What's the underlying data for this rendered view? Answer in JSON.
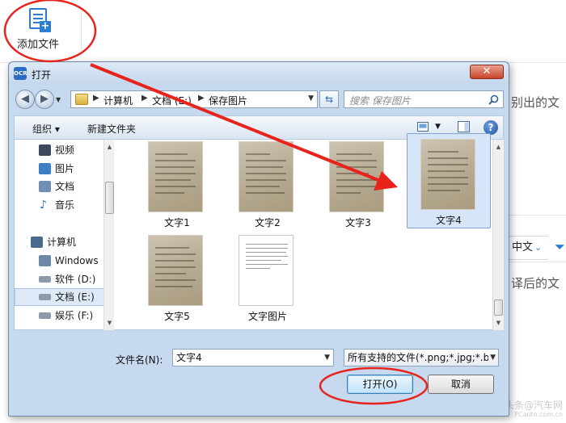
{
  "app": {
    "add_file_label": "添加文件",
    "bg_text_1": "别出的文",
    "bg_lang": "中文",
    "bg_text_2": "译后的文",
    "watermark": "头条@汽车网",
    "watermark_sub": "PCauto.com.cn"
  },
  "dialog": {
    "title": "打开",
    "close_glyph": "✕",
    "address": {
      "crumbs": [
        "计算机",
        "文档 (E:)",
        "保存图片"
      ]
    },
    "search": {
      "placeholder": "搜索 保存图片"
    },
    "command_bar": {
      "organize": "组织 ▾",
      "new_folder": "新建文件夹"
    },
    "nav_items": [
      {
        "label": "视频",
        "icon": "video-folder-icon",
        "color": "#3a4a5c"
      },
      {
        "label": "图片",
        "icon": "pictures-folder-icon",
        "color": "#3d7fc4"
      },
      {
        "label": "文档",
        "icon": "documents-folder-icon",
        "color": "#6f8fb3"
      },
      {
        "label": "音乐",
        "icon": "music-icon",
        "color": "#2a72c8"
      },
      {
        "label": "计算机",
        "icon": "computer-icon",
        "color": "#4b6a8e"
      },
      {
        "label": "Windows",
        "icon": "windows-drive-icon",
        "color": "#6e89a8"
      },
      {
        "label": "软件 (D:)",
        "icon": "drive-icon",
        "color": "#8d9aa8"
      },
      {
        "label": "文档 (E:)",
        "icon": "drive-icon",
        "color": "#8d9aa8"
      },
      {
        "label": "娱乐 (F:)",
        "icon": "drive-icon",
        "color": "#8d9aa8"
      }
    ],
    "files": [
      {
        "label": "文字1",
        "kind": "photo"
      },
      {
        "label": "文字2",
        "kind": "photo"
      },
      {
        "label": "文字3",
        "kind": "photo"
      },
      {
        "label": "文字4",
        "kind": "photo"
      },
      {
        "label": "文字5",
        "kind": "photo"
      },
      {
        "label": "文字图片",
        "kind": "document"
      }
    ],
    "selected_file": "文字4",
    "filename_label": "文件名(N):",
    "filename_value": "文字4",
    "filetype_value": "所有支持的文件(*.png;*.jpg;*.b",
    "open_button": "打开(O)",
    "cancel_button": "取消"
  },
  "colors": {
    "annotation": "#e8231c",
    "selection": "#d6e6f8",
    "accent": "#2b7cd3"
  }
}
